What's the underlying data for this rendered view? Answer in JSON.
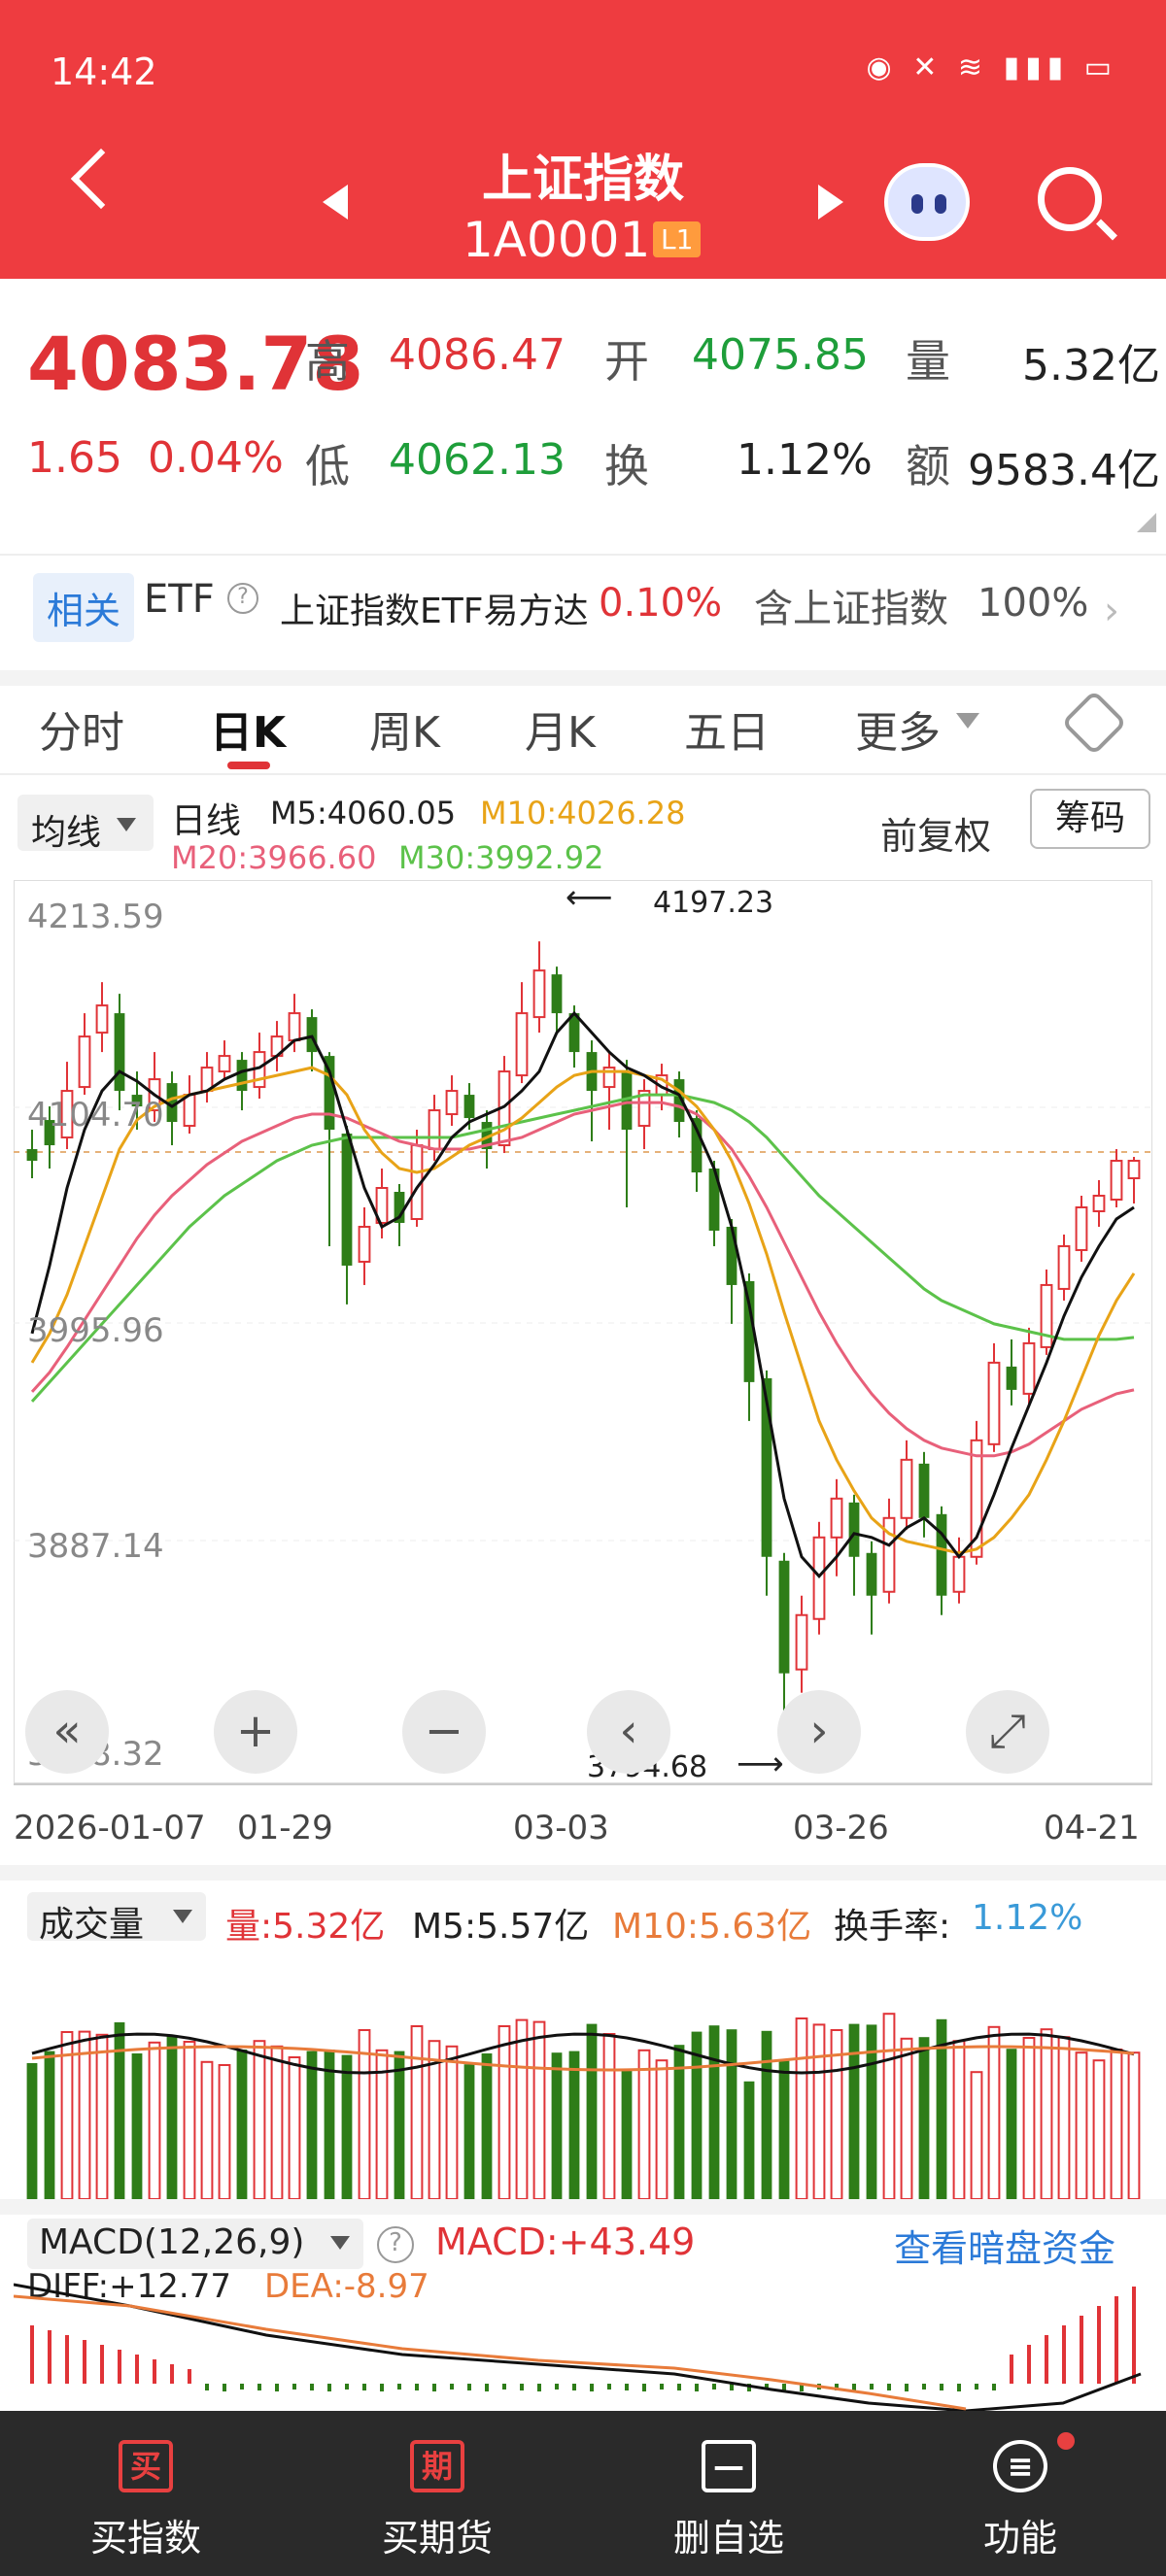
{
  "status_bar": {
    "time": "14:42",
    "icons": "eye-icon mute-icon wifi-icon 5g-icon signal-icon battery-icon"
  },
  "header": {
    "title": "上证指数",
    "code": "1A0001",
    "level_badge": "L1"
  },
  "quote": {
    "price": "4083.78",
    "change": "1.65",
    "change_pct": "0.04%",
    "labels": {
      "high": "高",
      "open": "开",
      "volume": "量",
      "low": "低",
      "turnover": "换",
      "amount": "额"
    },
    "high": "4086.47",
    "open": "4075.85",
    "volume": "5.32亿",
    "low": "4062.13",
    "turnover_rate": "1.12%",
    "amount": "9583.4亿"
  },
  "etf": {
    "tag": "相关",
    "label": "ETF",
    "name": "上证指数ETF易方达",
    "change": "0.10%",
    "contain_label": "含上证指数",
    "contain_pct": "100%"
  },
  "tabs": [
    "分时",
    "日K",
    "周K",
    "月K",
    "五日",
    "更多"
  ],
  "indicator": {
    "ma_selector": "均线",
    "kind": "日线",
    "m5": "M5:4060.05",
    "m10": "M10:4026.28",
    "m20": "M20:3966.60",
    "m30": "M30:3992.92",
    "adjust": "前复权",
    "chips": "筹码"
  },
  "chart_data": {
    "type": "candlestick",
    "y_ticks": [
      "4213.59",
      "4104.70",
      "3995.96",
      "3887.14",
      "3778.32"
    ],
    "x_ticks": [
      "2026-01-07",
      "01-29",
      "03-03",
      "03-26",
      "04-21"
    ],
    "annotation_high": "4197.23",
    "annotation_low": "3794.68",
    "candles": [
      [
        4090,
        4084,
        4100,
        4075
      ],
      [
        4105,
        4092,
        4112,
        4080
      ],
      [
        4096,
        4120,
        4135,
        4090
      ],
      [
        4122,
        4148,
        4160,
        4118
      ],
      [
        4150,
        4164,
        4176,
        4140
      ],
      [
        4160,
        4120,
        4170,
        4110
      ],
      [
        4118,
        4112,
        4130,
        4100
      ],
      [
        4110,
        4126,
        4140,
        4104
      ],
      [
        4124,
        4104,
        4130,
        4092
      ],
      [
        4102,
        4118,
        4128,
        4098
      ],
      [
        4120,
        4132,
        4140,
        4114
      ],
      [
        4130,
        4138,
        4146,
        4126
      ],
      [
        4136,
        4120,
        4140,
        4110
      ],
      [
        4122,
        4140,
        4150,
        4116
      ],
      [
        4138,
        4148,
        4156,
        4130
      ],
      [
        4146,
        4160,
        4170,
        4140
      ],
      [
        4158,
        4140,
        4162,
        4130
      ],
      [
        4138,
        4100,
        4140,
        4040
      ],
      [
        4098,
        4030,
        4102,
        4010
      ],
      [
        4032,
        4050,
        4060,
        4020
      ],
      [
        4052,
        4070,
        4080,
        4044
      ],
      [
        4068,
        4052,
        4072,
        4040
      ],
      [
        4054,
        4092,
        4100,
        4050
      ],
      [
        4090,
        4110,
        4118,
        4084
      ],
      [
        4108,
        4120,
        4128,
        4102
      ],
      [
        4118,
        4106,
        4124,
        4100
      ],
      [
        4104,
        4090,
        4110,
        4080
      ],
      [
        4092,
        4130,
        4138,
        4088
      ],
      [
        4128,
        4160,
        4176,
        4124
      ],
      [
        4158,
        4182,
        4197,
        4150
      ],
      [
        4180,
        4160,
        4184,
        4150
      ],
      [
        4160,
        4140,
        4164,
        4132
      ],
      [
        4140,
        4120,
        4146,
        4094
      ],
      [
        4122,
        4132,
        4140,
        4100
      ],
      [
        4130,
        4100,
        4136,
        4060
      ],
      [
        4102,
        4120,
        4126,
        4090
      ],
      [
        4118,
        4128,
        4134,
        4110
      ],
      [
        4126,
        4104,
        4130,
        4096
      ],
      [
        4106,
        4078,
        4110,
        4068
      ],
      [
        4080,
        4048,
        4084,
        4040
      ],
      [
        4050,
        4020,
        4054,
        4000
      ],
      [
        4022,
        3970,
        4026,
        3950
      ],
      [
        3972,
        3880,
        3976,
        3860
      ],
      [
        3878,
        3820,
        3882,
        3795
      ],
      [
        3822,
        3850,
        3860,
        3810
      ],
      [
        3848,
        3890,
        3898,
        3840
      ],
      [
        3890,
        3910,
        3920,
        3870
      ],
      [
        3908,
        3880,
        3912,
        3860
      ],
      [
        3882,
        3860,
        3888,
        3840
      ],
      [
        3862,
        3900,
        3910,
        3856
      ],
      [
        3900,
        3930,
        3940,
        3894
      ],
      [
        3928,
        3900,
        3934,
        3890
      ],
      [
        3902,
        3860,
        3906,
        3850
      ],
      [
        3862,
        3880,
        3890,
        3856
      ],
      [
        3880,
        3940,
        3950,
        3876
      ],
      [
        3938,
        3980,
        3990,
        3934
      ],
      [
        3978,
        3966,
        3992,
        3958
      ],
      [
        3964,
        3990,
        3998,
        3958
      ],
      [
        3988,
        4020,
        4028,
        3984
      ],
      [
        4018,
        4040,
        4046,
        4012
      ],
      [
        4038,
        4060,
        4066,
        4032
      ],
      [
        4058,
        4066,
        4074,
        4050
      ],
      [
        4064,
        4084,
        4090,
        4060
      ],
      [
        4075,
        4084,
        4086,
        4062
      ]
    ],
    "ma5_points": [
      3995,
      4030,
      4070,
      4100,
      4120,
      4130,
      4125,
      4118,
      4112,
      4118,
      4120,
      4126,
      4130,
      4132,
      4138,
      4146,
      4148,
      4130,
      4100,
      4070,
      4050,
      4055,
      4070,
      4082,
      4096,
      4104,
      4108,
      4112,
      4120,
      4130,
      4150,
      4160,
      4150,
      4140,
      4132,
      4128,
      4122,
      4118,
      4100,
      4080,
      4050,
      4010,
      3960,
      3910,
      3880,
      3870,
      3880,
      3892,
      3890,
      3886,
      3895,
      3900,
      3892,
      3880,
      3890,
      3912,
      3936,
      3958,
      3980,
      4004,
      4024,
      4040,
      4054,
      4060
    ],
    "ma10_points": [
      3980,
      3995,
      4015,
      4040,
      4065,
      4090,
      4105,
      4112,
      4116,
      4118,
      4120,
      4122,
      4124,
      4126,
      4128,
      4130,
      4132,
      4128,
      4118,
      4100,
      4088,
      4080,
      4078,
      4080,
      4086,
      4092,
      4096,
      4100,
      4106,
      4114,
      4122,
      4128,
      4130,
      4130,
      4130,
      4128,
      4126,
      4120,
      4112,
      4100,
      4084,
      4062,
      4036,
      4006,
      3978,
      3950,
      3930,
      3914,
      3900,
      3892,
      3888,
      3886,
      3884,
      3882,
      3884,
      3890,
      3900,
      3912,
      3930,
      3950,
      3972,
      3994,
      4012,
      4026
    ],
    "ma20_points": [
      3965,
      3975,
      3988,
      4002,
      4016,
      4030,
      4044,
      4056,
      4066,
      4074,
      4082,
      4088,
      4094,
      4098,
      4102,
      4106,
      4108,
      4108,
      4106,
      4102,
      4098,
      4094,
      4092,
      4090,
      4090,
      4090,
      4092,
      4094,
      4096,
      4100,
      4104,
      4108,
      4110,
      4112,
      4114,
      4114,
      4114,
      4112,
      4108,
      4100,
      4090,
      4076,
      4060,
      4042,
      4024,
      4006,
      3990,
      3976,
      3964,
      3954,
      3946,
      3940,
      3936,
      3934,
      3932,
      3932,
      3934,
      3938,
      3944,
      3950,
      3956,
      3960,
      3964,
      3966
    ],
    "ma30_points": [
      3960,
      3970,
      3980,
      3990,
      4000,
      4010,
      4020,
      4030,
      4040,
      4050,
      4058,
      4066,
      4072,
      4078,
      4084,
      4088,
      4092,
      4094,
      4096,
      4096,
      4096,
      4096,
      4096,
      4096,
      4096,
      4098,
      4100,
      4102,
      4104,
      4106,
      4108,
      4110,
      4112,
      4114,
      4116,
      4118,
      4118,
      4118,
      4116,
      4114,
      4110,
      4104,
      4096,
      4086,
      4076,
      4066,
      4058,
      4050,
      4042,
      4034,
      4026,
      4018,
      4012,
      4008,
      4004,
      4000,
      3998,
      3996,
      3994,
      3992,
      3992,
      3992,
      3992,
      3993
    ]
  },
  "volume": {
    "selector": "成交量",
    "vol": "量:5.32亿",
    "m5": "M5:5.57亿",
    "m10": "M10:5.63亿",
    "turn_label": "换手率:",
    "turn": "1.12%"
  },
  "macd": {
    "selector": "MACD(12,26,9)",
    "value": "MACD:+43.49",
    "link": "查看暗盘资金",
    "diff": "DIFF:+12.77",
    "dea": "DEA:-8.97"
  },
  "nav": [
    {
      "icon": "买",
      "label": "买指数"
    },
    {
      "icon": "期",
      "label": "买期货"
    },
    {
      "icon": "",
      "label": "删自选"
    },
    {
      "icon": "",
      "label": "功能"
    }
  ],
  "colors": {
    "up": "#e03337",
    "down": "#2e7d18",
    "ma5": "#111111",
    "ma10": "#e8a317",
    "ma20": "#e8607a",
    "ma30": "#5cc24a",
    "header_bg": "#ee3c40"
  }
}
